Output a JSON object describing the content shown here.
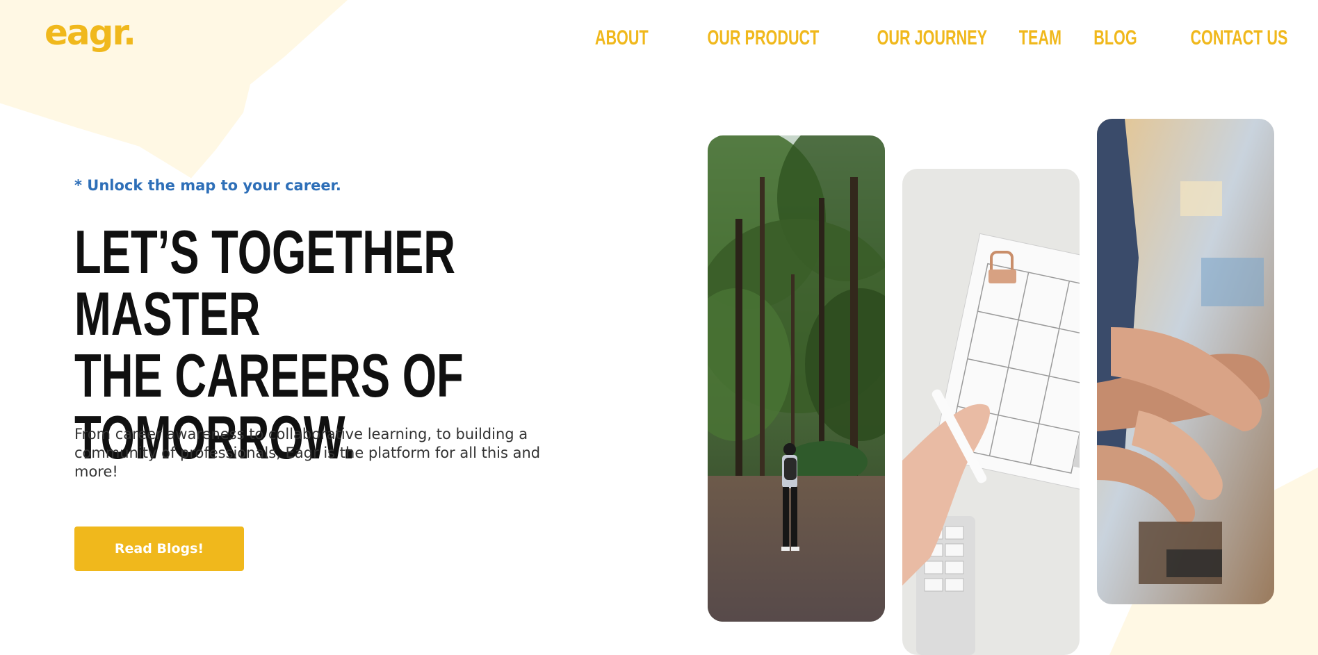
{
  "brand": {
    "logo_text": "eagr.",
    "accent_color": "#f0b81c",
    "tagline_color": "#2e6fb8"
  },
  "nav": {
    "items": [
      {
        "label": "ABOUT"
      },
      {
        "label": "OUR PRODUCT"
      },
      {
        "label": "OUR JOURNEY"
      },
      {
        "label": "TEAM"
      },
      {
        "label": "BLOG"
      },
      {
        "label": "CONTACT US"
      }
    ]
  },
  "hero": {
    "tagline": "* Unlock the map to your career.",
    "headline_lines": [
      "LET’S TOGETHER MASTER",
      "THE CAREERS OF",
      "TOMORROW."
    ],
    "description": "From career awareness to collaborative learning, to building a community of professionals, Eagr is the platform for all this and more!",
    "cta_label": "Read Blogs!"
  },
  "gallery": {
    "photos": [
      {
        "subject": "person-in-forest"
      },
      {
        "subject": "planner-on-desk"
      },
      {
        "subject": "team-hands-stacked"
      }
    ]
  }
}
